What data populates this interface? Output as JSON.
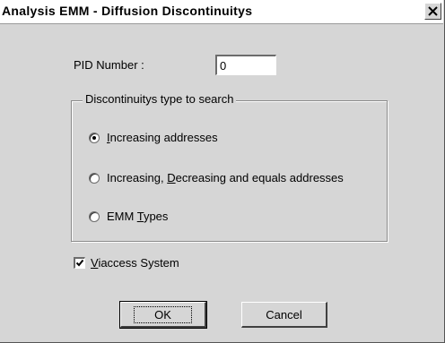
{
  "window": {
    "title": "Analysis EMM - Diffusion Discontinuitys",
    "close_glyph": "✕"
  },
  "pid": {
    "label": "PID Number :",
    "value": "0"
  },
  "group": {
    "title": "Discontinuitys type to search",
    "options": [
      {
        "pre": "",
        "mnemonic": "I",
        "post": "ncreasing addresses",
        "checked": true
      },
      {
        "pre": "Increasing, ",
        "mnemonic": "D",
        "post": "ecreasing and equals addresses",
        "checked": false
      },
      {
        "pre": "EMM ",
        "mnemonic": "T",
        "post": "ypes",
        "checked": false
      }
    ]
  },
  "viaccess": {
    "mnemonic": "V",
    "post": "iaccess System",
    "checked": true
  },
  "buttons": {
    "ok": "OK",
    "cancel": "Cancel"
  }
}
